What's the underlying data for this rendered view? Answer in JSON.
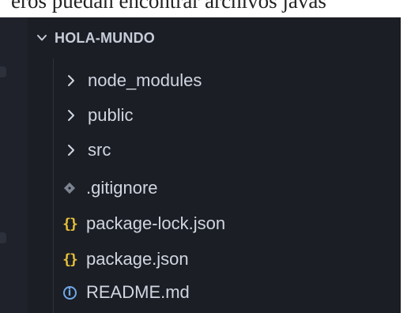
{
  "document": {
    "cropped_text": "eros puedan encontrar archivos javas"
  },
  "explorer": {
    "section_title": "HOLA-MUNDO",
    "items": [
      {
        "label": "node_modules",
        "type": "folder",
        "icon": "chevron-right-icon"
      },
      {
        "label": "public",
        "type": "folder",
        "icon": "chevron-right-icon"
      },
      {
        "label": "src",
        "type": "folder",
        "icon": "chevron-right-icon"
      },
      {
        "label": ".gitignore",
        "type": "file",
        "icon": "git-icon"
      },
      {
        "label": "package-lock.json",
        "type": "file",
        "icon": "json-braces-icon"
      },
      {
        "label": "package.json",
        "type": "file",
        "icon": "json-braces-icon"
      },
      {
        "label": "README.md",
        "type": "file",
        "icon": "info-icon"
      }
    ],
    "colors": {
      "background": "#1b1e25",
      "text": "#d0d6e0",
      "json_icon": "#e8c23a",
      "info_icon": "#6fa7e8",
      "git_icon": "#7d8390"
    }
  }
}
